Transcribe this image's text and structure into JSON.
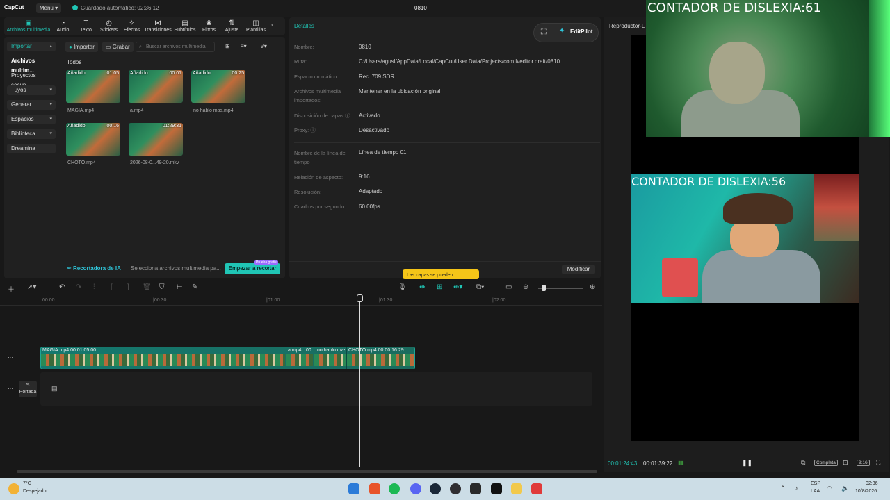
{
  "titlebar": {
    "logo": "CapCut",
    "menu": "Menú",
    "autosave": "Guardado automático: 02:36:12",
    "project": "0810"
  },
  "tabs": [
    {
      "icon": "media-icon",
      "glyph": "▣",
      "label": "Archivos multimedia"
    },
    {
      "icon": "audio-icon",
      "glyph": "◔",
      "label": "Audio"
    },
    {
      "icon": "text-icon",
      "glyph": "T",
      "label": "Texto"
    },
    {
      "icon": "stickers-icon",
      "glyph": "◴",
      "label": "Stickers"
    },
    {
      "icon": "effects-icon",
      "glyph": "✧",
      "label": "Efectos"
    },
    {
      "icon": "transitions-icon",
      "glyph": "⋈",
      "label": "Transiciones"
    },
    {
      "icon": "subtitles-icon",
      "glyph": "▤",
      "label": "Subtítulos"
    },
    {
      "icon": "filters-icon",
      "glyph": "❀",
      "label": "Filtros"
    },
    {
      "icon": "adjust-icon",
      "glyph": "⇅",
      "label": "Ajuste"
    },
    {
      "icon": "templates-icon",
      "glyph": "◫",
      "label": "Plantillas"
    }
  ],
  "sidebar": {
    "importar": "Importar",
    "archivos": "Archivos multim...",
    "proyectos": "Proyectos secun...",
    "tuyos": "Tuyos",
    "generar": "Generar",
    "espacios": "Espacios",
    "biblioteca": "Biblioteca",
    "dreamina": "Dreamina"
  },
  "media": {
    "import_btn": "Importar",
    "record_btn": "Grabar",
    "search_placeholder": "Buscar archivos multimedia",
    "todos": "Todos",
    "items": [
      {
        "tag": "Añadido",
        "duration": "01:05",
        "name": "MAGIA.mp4"
      },
      {
        "tag": "Añadido",
        "duration": "00:01",
        "name": "a.mp4"
      },
      {
        "tag": "Añadido",
        "duration": "00:25",
        "name": "no hablo mas.mp4"
      },
      {
        "tag": "Añadido",
        "duration": "00:16",
        "name": "CHOTO.mp4"
      },
      {
        "tag": "",
        "duration": "01:29:31",
        "name": "2026-08-0...49-20.mkv"
      }
    ],
    "ai_recorder": "Recortadora de IA",
    "ai_desc": "Selecciona archivos multimedia pa...",
    "start_crop": "Empezar a recortar",
    "new_badge": "Prueba gratis"
  },
  "details": {
    "title": "Detalles",
    "editpilot": "EditPilot",
    "rows": [
      {
        "label": "Nombre:",
        "value": "0810"
      },
      {
        "label": "Ruta:",
        "value": "C:/Users/agusl/AppData/Local/CapCut/User Data/Projects/com.lveditor.draft/0810"
      },
      {
        "label": "Espacio cromático",
        "value": "Rec. 709 SDR"
      },
      {
        "label": "Archivos multimedia importados:",
        "value": "Mantener en la ubicación original"
      },
      {
        "label": "Disposición de capas ⓘ",
        "value": "Activado"
      },
      {
        "label": "Proxy: ⓘ",
        "value": "Desactivado"
      },
      {
        "label": "Nombre de la línea de tiempo",
        "value": "Línea de tiempo 01"
      },
      {
        "label": "Relación de aspecto:",
        "value": "9:16"
      },
      {
        "label": "Resolución:",
        "value": "Adaptado"
      },
      {
        "label": "Cuadros por segundo:",
        "value": "60.00fps"
      }
    ],
    "tooltip": "Las capas se pueden",
    "modify": "Modificar"
  },
  "player": {
    "title": "Reproductor-L",
    "cam1_text": "CONTADOR DE DISLEXIA:61",
    "cam2_text": "CONTADOR DE DISLEXIA:56",
    "current_time": "00:01:24:43",
    "total_time": "00:01:39:22",
    "completa": "Completa",
    "ratio": "9:16"
  },
  "timeline": {
    "ruler": [
      "00:00",
      "|00:30",
      "|01:00",
      "|01:30",
      "|02:00"
    ],
    "clips": [
      {
        "label": "MAGIA.mp4  00:01:05:00"
      },
      {
        "label": "a.mp4"
      },
      {
        "label": "00:"
      },
      {
        "label": "no hablo mas"
      },
      {
        "label": "CHOTO.mp4  00:00:16:29"
      }
    ],
    "cover": "Portada"
  },
  "taskbar": {
    "temp": "7°C",
    "condition": "Despejado",
    "lang1": "ESP",
    "lang2": "LAA",
    "time": "02:36",
    "date": "10/8/2026",
    "apps": [
      {
        "icon": "windows-icon",
        "color": "#2b7bd8"
      },
      {
        "icon": "brave-icon",
        "color": "#e8542a"
      },
      {
        "icon": "spotify-icon",
        "color": "#1db954"
      },
      {
        "icon": "discord-icon",
        "color": "#5865f2"
      },
      {
        "icon": "steam-icon",
        "color": "#1b2838"
      },
      {
        "icon": "obs-icon",
        "color": "#302e31"
      },
      {
        "icon": "game-icon",
        "color": "#2a2a2a"
      },
      {
        "icon": "capcut-icon",
        "color": "#111111"
      },
      {
        "icon": "folder-icon",
        "color": "#f2c94c"
      },
      {
        "icon": "app-icon",
        "color": "#e03a3a"
      }
    ]
  }
}
